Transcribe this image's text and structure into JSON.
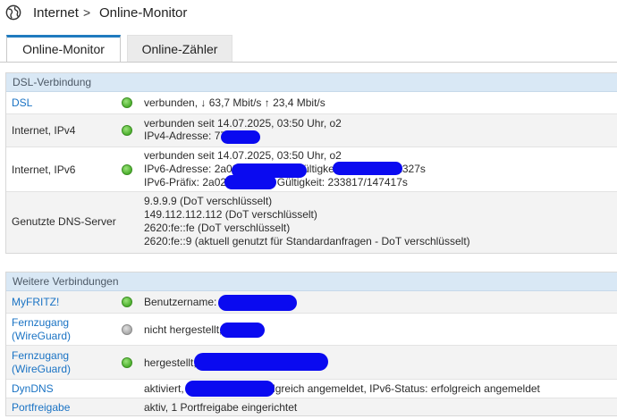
{
  "breadcrumb": {
    "root": "Internet",
    "separator": ">",
    "current": "Online-Monitor"
  },
  "tabs": [
    {
      "label": "Online-Monitor",
      "active": true
    },
    {
      "label": "Online-Zähler",
      "active": false
    }
  ],
  "dsl_section": {
    "title": "DSL-Verbindung",
    "rows": [
      {
        "label": "DSL",
        "status": "green",
        "lines": [
          "verbunden, ↓ 63,7 Mbit/s ↑ 23,4 Mbit/s"
        ]
      },
      {
        "label": "Internet, IPv4",
        "status": "green",
        "lines": [
          "verbunden seit 14.07.2025, 03:50 Uhr, o2",
          "IPv4-Adresse: 77"
        ]
      },
      {
        "label": "Internet, IPv6",
        "status": "green",
        "lines": [
          "verbunden seit 14.07.2025, 03:50 Uhr, o2",
          "IPv6-Adresse: 2a02:                      d0e4:                          /64, Gültigkeit: 258727/172327s",
          "IPv6-Präfix: 2a02:                  600::/56, Gültigkeit: 233817/147417s"
        ]
      },
      {
        "label": "Genutzte DNS-Server",
        "status": "none",
        "lines": [
          "9.9.9.9 (DoT verschlüsselt)",
          "149.112.112.112 (DoT verschlüsselt)",
          "2620:fe::fe (DoT verschlüsselt)",
          "2620:fe::9 (aktuell genutzt für Standardanfragen - DoT verschlüsselt)"
        ]
      }
    ]
  },
  "other_section": {
    "title": "Weitere Verbindungen",
    "rows": [
      {
        "label": "MyFRITZ!",
        "status": "green",
        "value": "Benutzername:"
      },
      {
        "label_lines": [
          "Fernzugang",
          "(WireGuard)"
        ],
        "status": "grey",
        "value": "nicht hergestellt,"
      },
      {
        "label_lines": [
          "Fernzugang",
          "(WireGuard)"
        ],
        "status": "green",
        "value": "hergestellt,"
      },
      {
        "label": "DynDNS",
        "status": "none",
        "value": "aktiviert,                              , IPv4-Status: erfolgreich angemeldet, IPv6-Status: erfolgreich angemeldet"
      },
      {
        "label": "Portfreigabe",
        "status": "none",
        "value": "aktiv, 1 Portfreigabe eingerichtet"
      }
    ]
  },
  "colors": {
    "accent": "#1f7bbf",
    "link": "#1a73c4",
    "section_header_bg": "#d9e8f5",
    "redaction": "#0a0af0"
  },
  "icons": {
    "header": "globe-icon"
  }
}
